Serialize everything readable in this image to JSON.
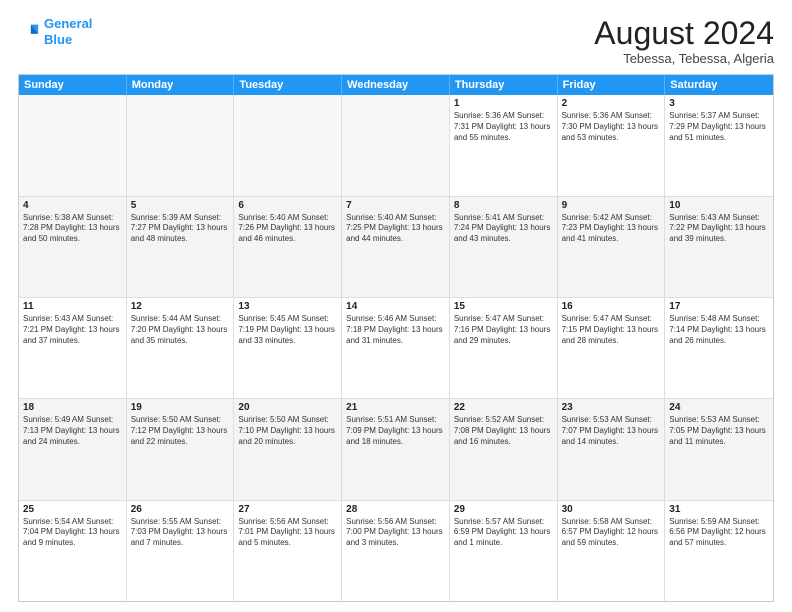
{
  "logo": {
    "line1": "General",
    "line2": "Blue"
  },
  "header": {
    "month": "August 2024",
    "location": "Tebessa, Tebessa, Algeria"
  },
  "weekdays": [
    "Sunday",
    "Monday",
    "Tuesday",
    "Wednesday",
    "Thursday",
    "Friday",
    "Saturday"
  ],
  "rows": [
    [
      {
        "date": "",
        "info": ""
      },
      {
        "date": "",
        "info": ""
      },
      {
        "date": "",
        "info": ""
      },
      {
        "date": "",
        "info": ""
      },
      {
        "date": "1",
        "info": "Sunrise: 5:36 AM\nSunset: 7:31 PM\nDaylight: 13 hours\nand 55 minutes."
      },
      {
        "date": "2",
        "info": "Sunrise: 5:36 AM\nSunset: 7:30 PM\nDaylight: 13 hours\nand 53 minutes."
      },
      {
        "date": "3",
        "info": "Sunrise: 5:37 AM\nSunset: 7:29 PM\nDaylight: 13 hours\nand 51 minutes."
      }
    ],
    [
      {
        "date": "4",
        "info": "Sunrise: 5:38 AM\nSunset: 7:28 PM\nDaylight: 13 hours\nand 50 minutes."
      },
      {
        "date": "5",
        "info": "Sunrise: 5:39 AM\nSunset: 7:27 PM\nDaylight: 13 hours\nand 48 minutes."
      },
      {
        "date": "6",
        "info": "Sunrise: 5:40 AM\nSunset: 7:26 PM\nDaylight: 13 hours\nand 46 minutes."
      },
      {
        "date": "7",
        "info": "Sunrise: 5:40 AM\nSunset: 7:25 PM\nDaylight: 13 hours\nand 44 minutes."
      },
      {
        "date": "8",
        "info": "Sunrise: 5:41 AM\nSunset: 7:24 PM\nDaylight: 13 hours\nand 43 minutes."
      },
      {
        "date": "9",
        "info": "Sunrise: 5:42 AM\nSunset: 7:23 PM\nDaylight: 13 hours\nand 41 minutes."
      },
      {
        "date": "10",
        "info": "Sunrise: 5:43 AM\nSunset: 7:22 PM\nDaylight: 13 hours\nand 39 minutes."
      }
    ],
    [
      {
        "date": "11",
        "info": "Sunrise: 5:43 AM\nSunset: 7:21 PM\nDaylight: 13 hours\nand 37 minutes."
      },
      {
        "date": "12",
        "info": "Sunrise: 5:44 AM\nSunset: 7:20 PM\nDaylight: 13 hours\nand 35 minutes."
      },
      {
        "date": "13",
        "info": "Sunrise: 5:45 AM\nSunset: 7:19 PM\nDaylight: 13 hours\nand 33 minutes."
      },
      {
        "date": "14",
        "info": "Sunrise: 5:46 AM\nSunset: 7:18 PM\nDaylight: 13 hours\nand 31 minutes."
      },
      {
        "date": "15",
        "info": "Sunrise: 5:47 AM\nSunset: 7:16 PM\nDaylight: 13 hours\nand 29 minutes."
      },
      {
        "date": "16",
        "info": "Sunrise: 5:47 AM\nSunset: 7:15 PM\nDaylight: 13 hours\nand 28 minutes."
      },
      {
        "date": "17",
        "info": "Sunrise: 5:48 AM\nSunset: 7:14 PM\nDaylight: 13 hours\nand 26 minutes."
      }
    ],
    [
      {
        "date": "18",
        "info": "Sunrise: 5:49 AM\nSunset: 7:13 PM\nDaylight: 13 hours\nand 24 minutes."
      },
      {
        "date": "19",
        "info": "Sunrise: 5:50 AM\nSunset: 7:12 PM\nDaylight: 13 hours\nand 22 minutes."
      },
      {
        "date": "20",
        "info": "Sunrise: 5:50 AM\nSunset: 7:10 PM\nDaylight: 13 hours\nand 20 minutes."
      },
      {
        "date": "21",
        "info": "Sunrise: 5:51 AM\nSunset: 7:09 PM\nDaylight: 13 hours\nand 18 minutes."
      },
      {
        "date": "22",
        "info": "Sunrise: 5:52 AM\nSunset: 7:08 PM\nDaylight: 13 hours\nand 16 minutes."
      },
      {
        "date": "23",
        "info": "Sunrise: 5:53 AM\nSunset: 7:07 PM\nDaylight: 13 hours\nand 14 minutes."
      },
      {
        "date": "24",
        "info": "Sunrise: 5:53 AM\nSunset: 7:05 PM\nDaylight: 13 hours\nand 11 minutes."
      }
    ],
    [
      {
        "date": "25",
        "info": "Sunrise: 5:54 AM\nSunset: 7:04 PM\nDaylight: 13 hours\nand 9 minutes."
      },
      {
        "date": "26",
        "info": "Sunrise: 5:55 AM\nSunset: 7:03 PM\nDaylight: 13 hours\nand 7 minutes."
      },
      {
        "date": "27",
        "info": "Sunrise: 5:56 AM\nSunset: 7:01 PM\nDaylight: 13 hours\nand 5 minutes."
      },
      {
        "date": "28",
        "info": "Sunrise: 5:56 AM\nSunset: 7:00 PM\nDaylight: 13 hours\nand 3 minutes."
      },
      {
        "date": "29",
        "info": "Sunrise: 5:57 AM\nSunset: 6:59 PM\nDaylight: 13 hours\nand 1 minute."
      },
      {
        "date": "30",
        "info": "Sunrise: 5:58 AM\nSunset: 6:57 PM\nDaylight: 12 hours\nand 59 minutes."
      },
      {
        "date": "31",
        "info": "Sunrise: 5:59 AM\nSunset: 6:56 PM\nDaylight: 12 hours\nand 57 minutes."
      }
    ]
  ]
}
